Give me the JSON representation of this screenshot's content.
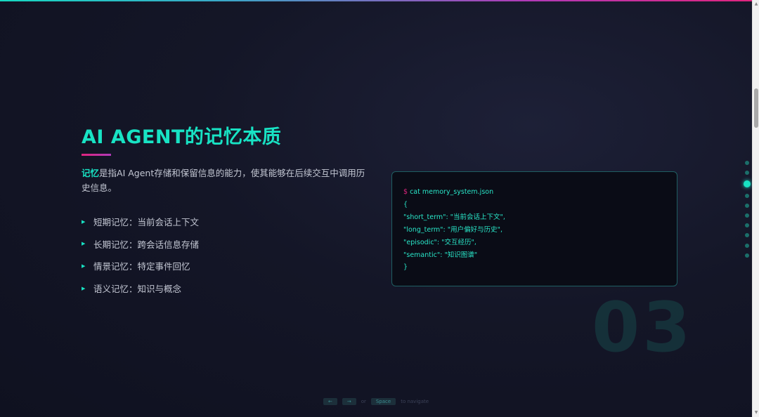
{
  "slide": {
    "title": "AI AGENT的记忆本质",
    "desc_highlight": "记忆",
    "desc_rest": "是指AI Agent存储和保留信息的能力，使其能够在后续交互中调用历史信息。",
    "features": [
      "短期记忆：当前会话上下文",
      "长期记忆：跨会话信息存储",
      "情景记忆：特定事件回忆",
      "语义记忆：知识与概念"
    ],
    "number": "03"
  },
  "terminal": {
    "prompt": "$",
    "command": "cat memory_system.json",
    "lines": [
      "{",
      "\"short_term\": \"当前会话上下文\",",
      "\"long_term\": \"用户偏好与历史\",",
      "\"episodic\": \"交互经历\",",
      "\"semantic\": \"知识图谱\"",
      "}"
    ]
  },
  "nav": {
    "prev_key": "←",
    "next_key": "→",
    "or_text": "or",
    "space_key": "Space",
    "hint_text": "to navigate",
    "dot_count": 10,
    "active_index": 2
  },
  "colors": {
    "accent": "#18e3c4",
    "pink": "#e0247e",
    "background": "#141627"
  }
}
